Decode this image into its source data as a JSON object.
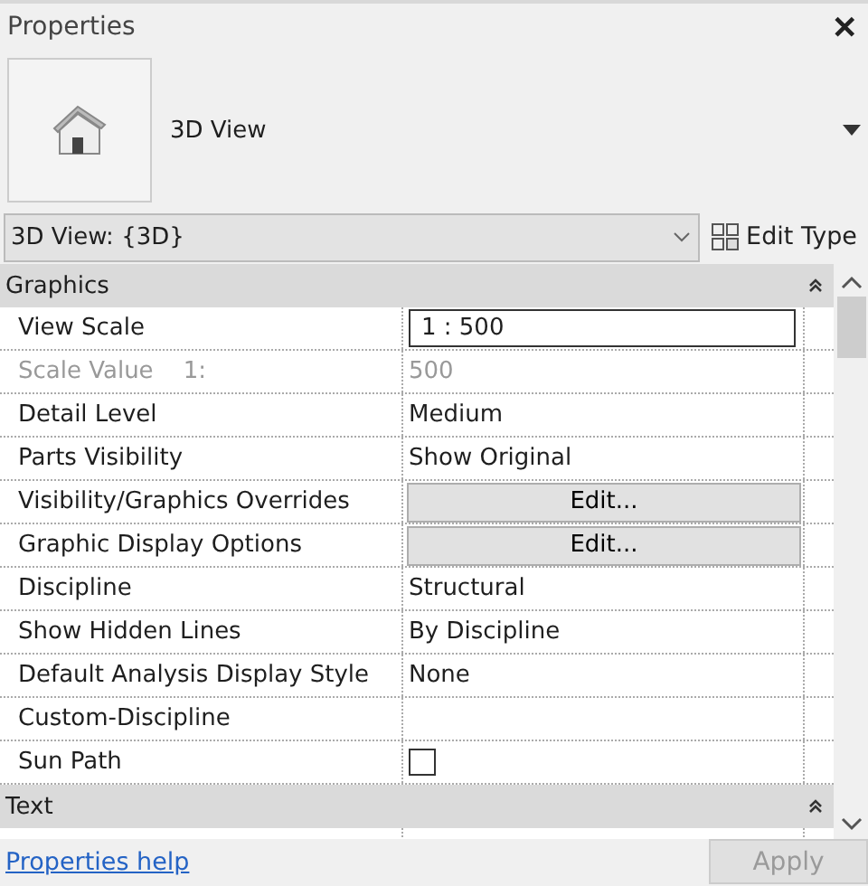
{
  "panel": {
    "title": "Properties",
    "close": "✕"
  },
  "type_preview": {
    "label": "3D View"
  },
  "type_selector": {
    "value": "3D View: {3D}",
    "edit_type": "Edit Type"
  },
  "sections": [
    {
      "title": "Graphics",
      "expanded": true,
      "rows": [
        {
          "name": "View Scale",
          "kind": "input",
          "value": "1 : 500",
          "disabled": false
        },
        {
          "name": "Scale Value    1:",
          "kind": "text",
          "value": "500",
          "disabled": true
        },
        {
          "name": "Detail Level",
          "kind": "text",
          "value": "Medium",
          "disabled": false
        },
        {
          "name": "Parts Visibility",
          "kind": "text",
          "value": "Show Original",
          "disabled": false
        },
        {
          "name": "Visibility/Graphics Overrides",
          "kind": "button",
          "value": "Edit...",
          "disabled": false
        },
        {
          "name": "Graphic Display Options",
          "kind": "button",
          "value": "Edit...",
          "disabled": false
        },
        {
          "name": "Discipline",
          "kind": "text",
          "value": "Structural",
          "disabled": false
        },
        {
          "name": "Show Hidden Lines",
          "kind": "text",
          "value": "By Discipline",
          "disabled": false
        },
        {
          "name": "Default Analysis Display Style",
          "kind": "text",
          "value": "None",
          "disabled": false
        },
        {
          "name": "Custom-Discipline",
          "kind": "text",
          "disabled": false
        },
        {
          "name": "Sun Path",
          "kind": "checkbox",
          "checked": false
        }
      ]
    },
    {
      "title": "Text",
      "expanded": true
    }
  ],
  "footer": {
    "help_link": "Properties help",
    "apply": "Apply",
    "apply_disabled": true
  }
}
